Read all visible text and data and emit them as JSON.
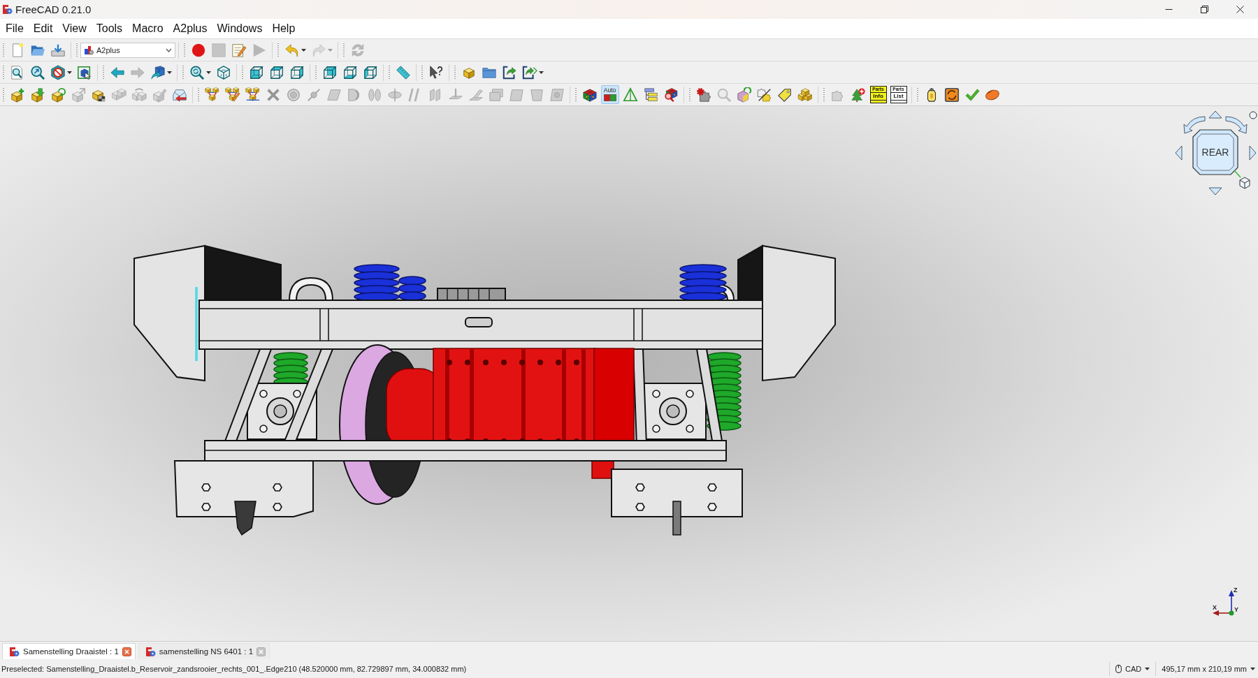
{
  "window": {
    "title": "FreeCAD 0.21.0"
  },
  "menu": [
    {
      "label": "File"
    },
    {
      "label": "Edit"
    },
    {
      "label": "View"
    },
    {
      "label": "Tools"
    },
    {
      "label": "Macro"
    },
    {
      "label": "A2plus"
    },
    {
      "label": "Windows"
    },
    {
      "label": "Help"
    }
  ],
  "toolbar_rows": [
    [
      [
        {
          "kind": "newfile",
          "disabled": false,
          "dropdown": false
        },
        {
          "kind": "open",
          "disabled": false,
          "dropdown": false
        },
        {
          "kind": "save",
          "disabled": false,
          "dropdown": false
        }
      ],
      [
        {
          "kind": "combo",
          "value": "A2plus",
          "disabled": false,
          "dropdown": true
        }
      ],
      [
        {
          "kind": "record",
          "disabled": false,
          "dropdown": false
        },
        {
          "kind": "stop",
          "disabled": true,
          "dropdown": false
        },
        {
          "kind": "macroedit",
          "disabled": false,
          "dropdown": false
        },
        {
          "kind": "play",
          "disabled": true,
          "dropdown": false
        }
      ],
      [
        {
          "kind": "undo",
          "disabled": false,
          "dropdown": true
        },
        {
          "kind": "redo",
          "disabled": true,
          "dropdown": true
        }
      ],
      [
        {
          "kind": "refresh",
          "disabled": true,
          "dropdown": false
        }
      ]
    ],
    [
      [
        {
          "kind": "fitall",
          "disabled": false,
          "dropdown": false
        },
        {
          "kind": "fitselection",
          "disabled": false,
          "dropdown": false
        },
        {
          "kind": "drawstyle",
          "disabled": false,
          "dropdown": true
        },
        {
          "kind": "boundbox",
          "disabled": false,
          "dropdown": false
        }
      ],
      [
        {
          "kind": "back",
          "disabled": false,
          "dropdown": false
        },
        {
          "kind": "forward",
          "disabled": true,
          "dropdown": false
        },
        {
          "kind": "stdviews",
          "disabled": false,
          "dropdown": true
        }
      ],
      [
        {
          "kind": "zoomsync",
          "disabled": false,
          "dropdown": true
        },
        {
          "kind": "isometric",
          "disabled": false,
          "dropdown": false
        }
      ],
      [
        {
          "kind": "front",
          "disabled": false,
          "dropdown": false
        },
        {
          "kind": "top",
          "disabled": false,
          "dropdown": false
        },
        {
          "kind": "right",
          "disabled": false,
          "dropdown": false
        }
      ],
      [
        {
          "kind": "rear",
          "disabled": false,
          "dropdown": false
        },
        {
          "kind": "bottom",
          "disabled": false,
          "dropdown": false
        },
        {
          "kind": "left",
          "disabled": false,
          "dropdown": false
        }
      ],
      [
        {
          "kind": "measure",
          "disabled": false,
          "dropdown": false
        }
      ],
      [
        {
          "kind": "whatsthis",
          "disabled": false,
          "dropdown": false
        }
      ],
      [
        {
          "kind": "partblock",
          "disabled": false,
          "dropdown": false
        },
        {
          "kind": "folder",
          "disabled": false,
          "dropdown": false
        },
        {
          "kind": "importshape",
          "disabled": false,
          "dropdown": false
        },
        {
          "kind": "importmulti",
          "disabled": false,
          "dropdown": true
        }
      ]
    ],
    [
      [
        {
          "kind": "addpart",
          "disabled": false,
          "dropdown": false
        },
        {
          "kind": "addpartdown",
          "disabled": false,
          "dropdown": false
        },
        {
          "kind": "updatepart",
          "disabled": false,
          "dropdown": false
        },
        {
          "kind": "editpart",
          "disabled": true,
          "dropdown": false
        },
        {
          "kind": "convertpart",
          "disabled": false,
          "dropdown": false
        },
        {
          "kind": "duplicate",
          "disabled": true,
          "dropdown": false
        },
        {
          "kind": "movepart",
          "disabled": true,
          "dropdown": false
        },
        {
          "kind": "pencilpart",
          "disabled": true,
          "dropdown": false
        },
        {
          "kind": "importarrow",
          "disabled": false,
          "dropdown": false
        }
      ],
      [
        {
          "kind": "constraints",
          "disabled": false,
          "dropdown": false
        },
        {
          "kind": "constraintsedit",
          "disabled": false,
          "dropdown": false
        },
        {
          "kind": "constraintsgroup",
          "disabled": false,
          "dropdown": false
        },
        {
          "kind": "delete",
          "disabled": true,
          "dropdown": false
        },
        {
          "kind": "circular",
          "disabled": true,
          "dropdown": false
        },
        {
          "kind": "pointonline",
          "disabled": true,
          "dropdown": false
        },
        {
          "kind": "planar",
          "disabled": true,
          "dropdown": false
        },
        {
          "kind": "cylinder",
          "disabled": true,
          "dropdown": false
        },
        {
          "kind": "doubleaxis",
          "disabled": true,
          "dropdown": false
        },
        {
          "kind": "disc",
          "disabled": true,
          "dropdown": false
        },
        {
          "kind": "slashes",
          "disabled": true,
          "dropdown": false
        },
        {
          "kind": "parallel",
          "disabled": true,
          "dropdown": false
        },
        {
          "kind": "perpendicular",
          "disabled": true,
          "dropdown": false
        },
        {
          "kind": "angle",
          "disabled": true,
          "dropdown": false
        },
        {
          "kind": "stack",
          "disabled": true,
          "dropdown": false
        },
        {
          "kind": "square",
          "disabled": true,
          "dropdown": false
        },
        {
          "kind": "skew",
          "disabled": true,
          "dropdown": false
        },
        {
          "kind": "squarecircle",
          "disabled": true,
          "dropdown": false
        }
      ],
      [
        {
          "kind": "rubik",
          "disabled": false,
          "dropdown": false
        },
        {
          "kind": "toggle",
          "label": "Auto",
          "selected": true,
          "disabled": false,
          "dropdown": false
        },
        {
          "kind": "triangle",
          "disabled": false,
          "dropdown": false
        },
        {
          "kind": "bars",
          "disabled": false,
          "dropdown": false
        },
        {
          "kind": "rubikzoom",
          "disabled": false,
          "dropdown": false
        }
      ],
      [
        {
          "kind": "gearpuzzle",
          "disabled": false,
          "dropdown": false
        },
        {
          "kind": "magnifier",
          "disabled": true,
          "dropdown": false
        },
        {
          "kind": "cuberefresh",
          "disabled": false,
          "dropdown": false
        },
        {
          "kind": "puzzleslash",
          "disabled": false,
          "dropdown": false
        },
        {
          "kind": "tag",
          "disabled": false,
          "dropdown": false
        },
        {
          "kind": "blocks",
          "disabled": false,
          "dropdown": false
        }
      ],
      [
        {
          "kind": "puzzle",
          "disabled": true,
          "dropdown": false
        },
        {
          "kind": "treeplus",
          "disabled": false,
          "dropdown": false
        },
        {
          "kind": "label",
          "lines": [
            "Parts",
            "Info"
          ],
          "color": "#f2f21a",
          "disabled": false,
          "dropdown": false
        },
        {
          "kind": "label",
          "lines": [
            "Parts",
            "List"
          ],
          "color": "#ffffff",
          "disabled": false,
          "dropdown": false
        }
      ],
      [
        {
          "kind": "lantern",
          "disabled": false,
          "dropdown": false
        },
        {
          "kind": "orangerefresh",
          "disabled": false,
          "dropdown": false
        },
        {
          "kind": "check",
          "disabled": false,
          "dropdown": false
        },
        {
          "kind": "mouse",
          "disabled": false,
          "dropdown": false
        }
      ]
    ]
  ],
  "view_cube": {
    "face": "REAR"
  },
  "axes": [
    {
      "kind": "up",
      "label": "Z",
      "color": "#1f2fb0"
    },
    {
      "kind": "left",
      "label": "X",
      "color": "#a81c1c"
    },
    {
      "kind": "point",
      "label": "Y",
      "color": "#1e9a2a"
    }
  ],
  "document_tabs": [
    {
      "label": "Samenstelling Draaistel : 1",
      "selected": true
    },
    {
      "label": "samenstelling NS 6401 : 1",
      "selected": false
    }
  ],
  "status_bar": {
    "message": "Preselected: Samenstelling_Draaistel.b_Reservoir_zandsrooier_rechts_001_.Edge210 (48.520000 mm, 82.729897 mm, 34.000832 mm)",
    "navigation_style": "CAD",
    "dimensions": "495,17 mm x 210,19 mm"
  }
}
